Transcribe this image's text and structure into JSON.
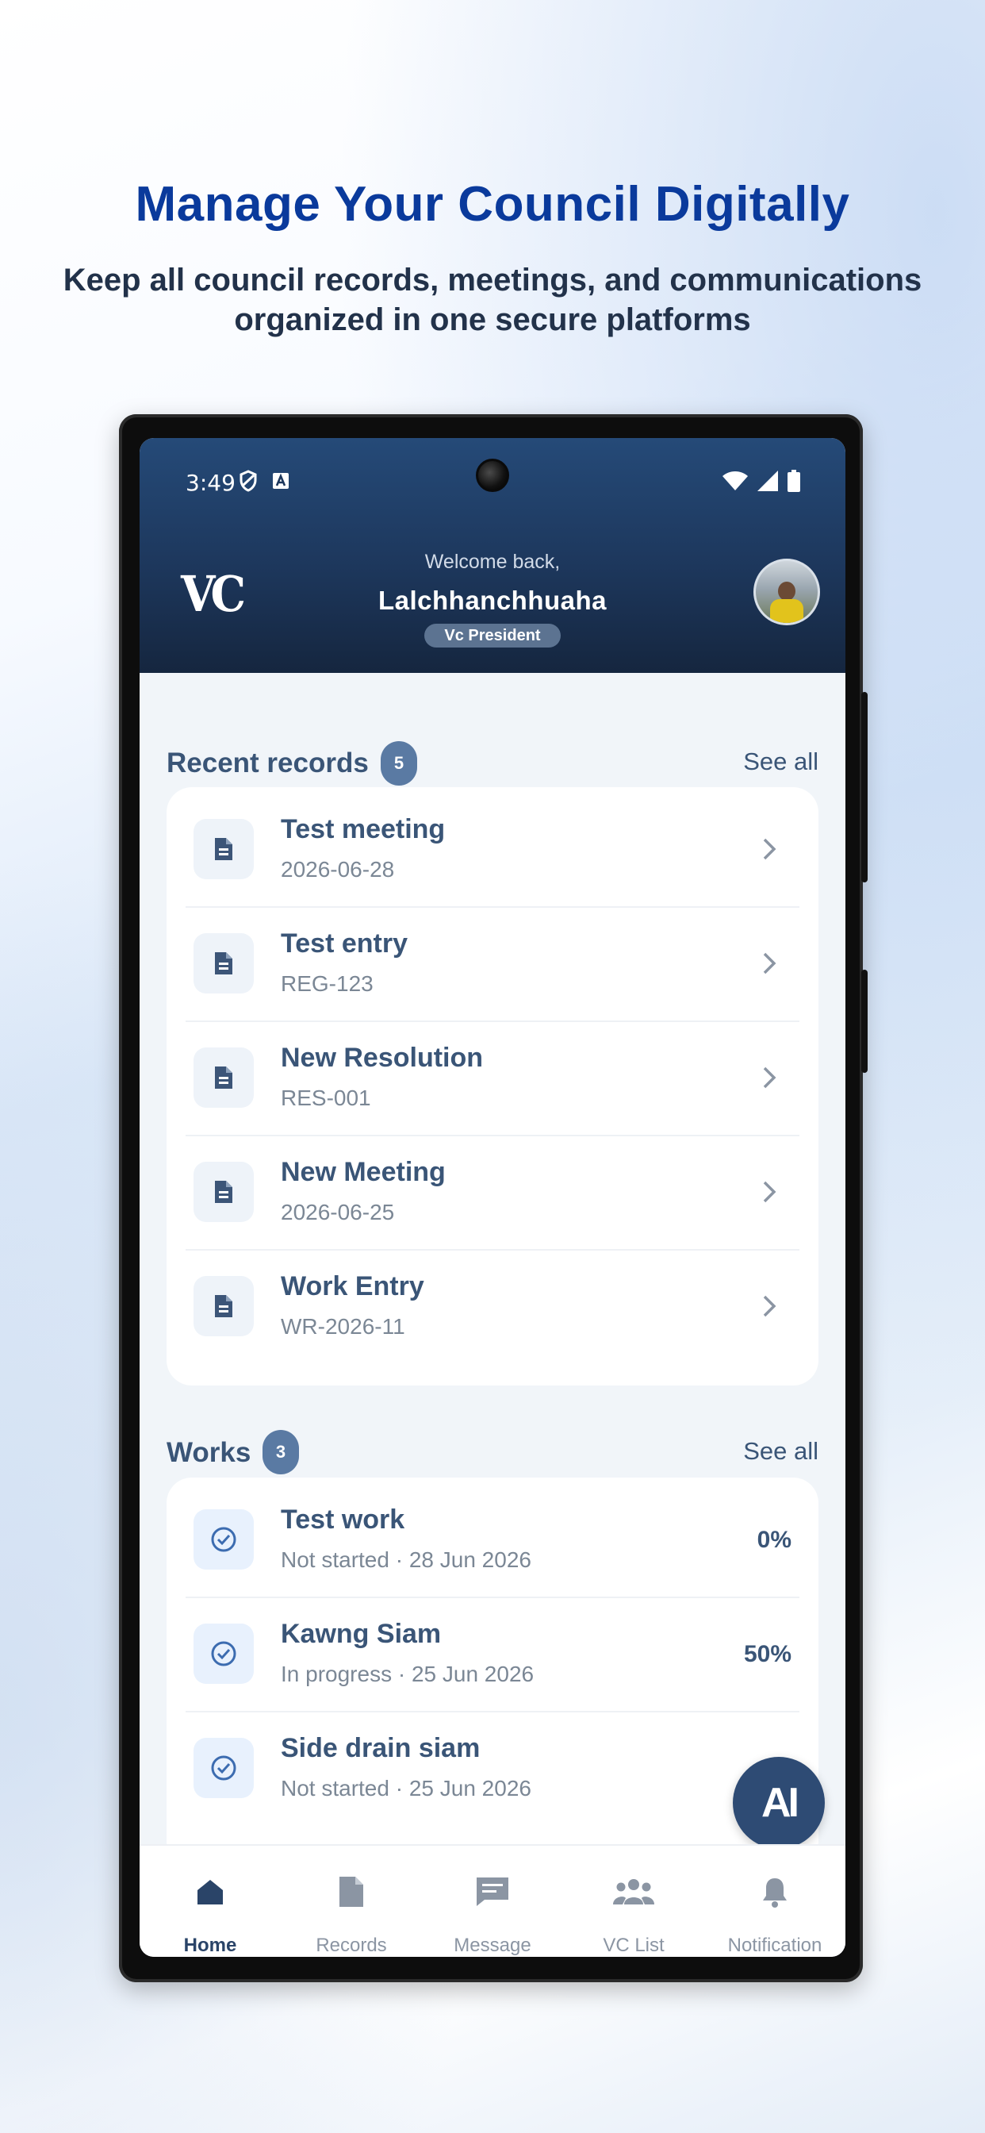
{
  "promo": {
    "headline": "Manage Your Council Digitally",
    "subline": "Keep all council records, meetings, and communications organized in one secure platforms"
  },
  "status_bar": {
    "time": "3:49",
    "icons": [
      "shield-icon",
      "a-icon",
      "wifi-icon",
      "signal-icon",
      "battery-icon"
    ]
  },
  "header": {
    "logo": "VC",
    "welcome": "Welcome back,",
    "user_name": "Lalchhanchhuaha",
    "role": "Vc President"
  },
  "recent_records": {
    "title": "Recent records",
    "count": "5",
    "see_all": "See all",
    "items": [
      {
        "title": "Test meeting",
        "sub": "2026-06-28"
      },
      {
        "title": "Test entry",
        "sub": "REG-123"
      },
      {
        "title": "New Resolution",
        "sub": "RES-001"
      },
      {
        "title": "New Meeting",
        "sub": "2026-06-25"
      },
      {
        "title": "Work Entry",
        "sub": "WR-2026-11"
      }
    ]
  },
  "works": {
    "title": "Works",
    "count": "3",
    "see_all": "See all",
    "items": [
      {
        "title": "Test work",
        "sub": "Not started · 28 Jun 2026",
        "progress": "0%"
      },
      {
        "title": "Kawng Siam",
        "sub": "In progress · 25 Jun 2026",
        "progress": "50%"
      },
      {
        "title": "Side drain siam",
        "sub": "Not started · 25 Jun 2026",
        "progress": ""
      }
    ]
  },
  "ai_button": {
    "label": "AI"
  },
  "nav": {
    "items": [
      {
        "label": "Home",
        "icon": "home-icon",
        "active": true
      },
      {
        "label": "Records",
        "icon": "file-icon",
        "active": false
      },
      {
        "label": "Message",
        "icon": "message-icon",
        "active": false
      },
      {
        "label": "VC List",
        "icon": "group-icon",
        "active": false
      },
      {
        "label": "Notification",
        "icon": "bell-icon",
        "active": false
      }
    ]
  },
  "colors": {
    "headline": "#0a3a9c",
    "header_bg": "#1d375c",
    "accent": "#3a5577",
    "badge": "#5a7aa3"
  }
}
